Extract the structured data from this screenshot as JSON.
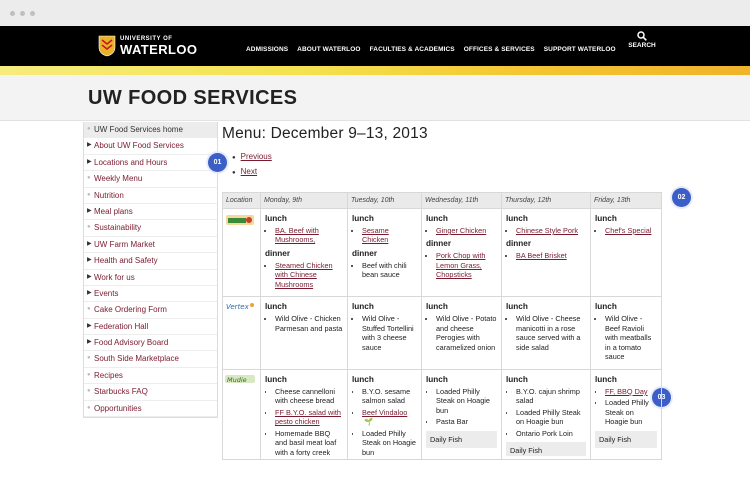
{
  "top": {
    "logo_line1": "UNIVERSITY OF",
    "logo_line2": "WATERLOO",
    "nav": [
      "ADMISSIONS",
      "ABOUT WATERLOO",
      "FACULTIES & ACADEMICS",
      "OFFICES & SERVICES",
      "SUPPORT WATERLOO"
    ],
    "search_label": "SEARCH"
  },
  "header": {
    "title": "UW FOOD SERVICES"
  },
  "sidebar": {
    "items": [
      {
        "label": "UW Food Services home",
        "marker": "dot",
        "active": true
      },
      {
        "label": "About UW Food Services",
        "marker": "tri"
      },
      {
        "label": "Locations and Hours",
        "marker": "tri"
      },
      {
        "label": "Weekly Menu",
        "marker": "dot"
      },
      {
        "label": "Nutrition",
        "marker": "dot"
      },
      {
        "label": "Meal plans",
        "marker": "tri"
      },
      {
        "label": "Sustainability",
        "marker": "dot"
      },
      {
        "label": "UW Farm Market",
        "marker": "tri"
      },
      {
        "label": "Health and Safety",
        "marker": "tri"
      },
      {
        "label": "Work for us",
        "marker": "tri"
      },
      {
        "label": "Events",
        "marker": "tri"
      },
      {
        "label": "Cake Ordering Form",
        "marker": "dot"
      },
      {
        "label": "Federation Hall",
        "marker": "tri"
      },
      {
        "label": "Food Advisory Board",
        "marker": "tri"
      },
      {
        "label": "South Side Marketplace",
        "marker": "dot"
      },
      {
        "label": "Recipes",
        "marker": "dot"
      },
      {
        "label": "Starbucks FAQ",
        "marker": "dot"
      },
      {
        "label": "Opportunities",
        "marker": "dot"
      }
    ]
  },
  "main": {
    "title": "Menu: December 9–13, 2013",
    "previous": "Previous",
    "next": "Next"
  },
  "badges": [
    "01",
    "02",
    "03"
  ],
  "table": {
    "headers": [
      "Location",
      "Monday, 9th",
      "Tuesday, 10th",
      "Wednesday, 11th",
      "Thursday, 12th",
      "Friday, 13th"
    ],
    "lunch": "lunch",
    "dinner": "dinner",
    "daily_fish": "Daily Fish",
    "rows": [
      {
        "mon": {
          "lunch": [
            {
              "t": "BA. Beef with Mushrooms,",
              "link": true
            }
          ],
          "dinner": [
            {
              "t": "Steamed Chicken with Chinese Mushrooms",
              "link": true
            }
          ]
        },
        "tue": {
          "lunch": [
            {
              "t": "Sesame Chicken",
              "link": true
            }
          ],
          "dinner": [
            {
              "t": "Beef with chili bean sauce",
              "link": false
            }
          ]
        },
        "wed": {
          "lunch": [
            {
              "t": "Ginger Chicken",
              "link": true
            }
          ],
          "dinner": [
            {
              "t": "Pork Chop with Lemon Grass, Chopsticks",
              "link": true
            }
          ]
        },
        "thu": {
          "lunch": [
            {
              "t": "Chinese Style Pork",
              "link": true
            }
          ],
          "dinner": [
            {
              "t": "BA Beef Brisket",
              "link": true
            }
          ]
        },
        "fri": {
          "lunch": [
            {
              "t": "Chef's Special",
              "link": true
            }
          ]
        }
      },
      {
        "mon": {
          "lunch": [
            {
              "t": "Wild Olive - Chicken Parmesan and pasta",
              "link": false
            }
          ]
        },
        "tue": {
          "lunch": [
            {
              "t": "Wild Olive - Stuffed Tortellini with 3 cheese sauce",
              "link": false
            }
          ]
        },
        "wed": {
          "lunch": [
            {
              "t": "Wild Olive - Potato and cheese Perogies with caramelized onion",
              "link": false
            }
          ]
        },
        "thu": {
          "lunch": [
            {
              "t": "Wild Olive - Cheese manicotti in a rose sauce served with a side salad",
              "link": false
            }
          ]
        },
        "fri": {
          "lunch": [
            {
              "t": "Wild Olive - Beef Ravioli with meatballs in a tomato sauce",
              "link": false
            }
          ]
        }
      },
      {
        "mon": {
          "lunch": [
            {
              "t": "Cheese cannelloni with cheese bread",
              "link": false
            },
            {
              "t": "FF B.Y.O. salad with pesto chicken",
              "link": true
            },
            {
              "t": "Homemade BBQ and basil meat loaf with a forty creek whiskey sauce",
              "link": false
            },
            {
              "t": "Loaded Philly Steak on Hoagie bun",
              "link": false
            }
          ]
        },
        "tue": {
          "lunch": [
            {
              "t": "B.Y.O. sesame salmon salad",
              "link": false
            },
            {
              "t": "Beef Vindaloo",
              "link": true,
              "leaf": "🌱"
            },
            {
              "t": "Loaded Philly Steak on Hoagie bun",
              "link": false
            },
            {
              "t": "Soy Beef Vindaloo",
              "link": false
            }
          ]
        },
        "wed": {
          "lunch": [
            {
              "t": "Loaded Philly Steak on Hoagie bun",
              "link": false
            },
            {
              "t": "Pasta Bar",
              "link": false
            }
          ],
          "fish": true
        },
        "thu": {
          "lunch": [
            {
              "t": "B.Y.O. cajun shrimp salad",
              "link": false
            },
            {
              "t": "Loaded Philly Steak on Hoagie bun",
              "link": false
            },
            {
              "t": "Ontario Pork Loin",
              "link": false
            }
          ],
          "fish": true
        },
        "fri": {
          "lunch": [
            {
              "t": "FF, BBQ Day",
              "link": true
            },
            {
              "t": "Loaded Philly Steak on Hoagie bun",
              "link": false
            }
          ],
          "fish": true
        }
      }
    ]
  }
}
